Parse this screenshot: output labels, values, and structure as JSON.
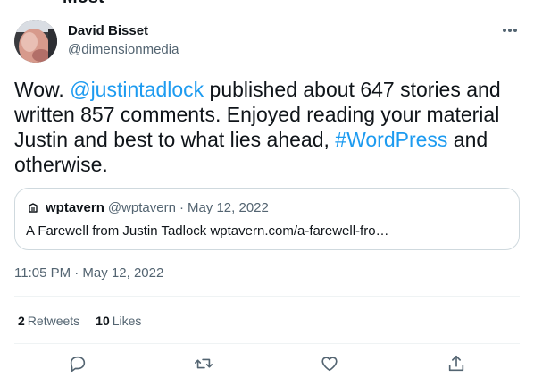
{
  "header": {
    "title_fragment": "Most"
  },
  "tweet": {
    "author": {
      "display_name": "David Bisset",
      "handle": "@dimensionmedia"
    },
    "text": {
      "p1": "Wow. ",
      "mention": "@justintadlock",
      "p2": " published about 647 stories and written 857 comments. Enjoyed reading your material Justin and best to what lies ahead, ",
      "hashtag": "#WordPress",
      "p3": " and otherwise."
    },
    "quote": {
      "name": "wptavern",
      "handle": "@wptavern",
      "separator": "·",
      "date": "May 12, 2022",
      "body": "A Farewell from Justin Tadlock wptavern.com/a-farewell-fro…"
    },
    "timestamp": "11:05 PM · May 12, 2022",
    "stats": {
      "retweets_count": "2",
      "retweets_label": "Retweets",
      "likes_count": "10",
      "likes_label": "Likes"
    },
    "actions": [
      "reply-icon",
      "retweet-icon",
      "like-icon",
      "share-icon"
    ]
  },
  "colors": {
    "link": "#1d9bf0",
    "text": "#0f1419",
    "secondary": "#536471",
    "border": "#cfd9de",
    "divider": "#eff3f4"
  }
}
